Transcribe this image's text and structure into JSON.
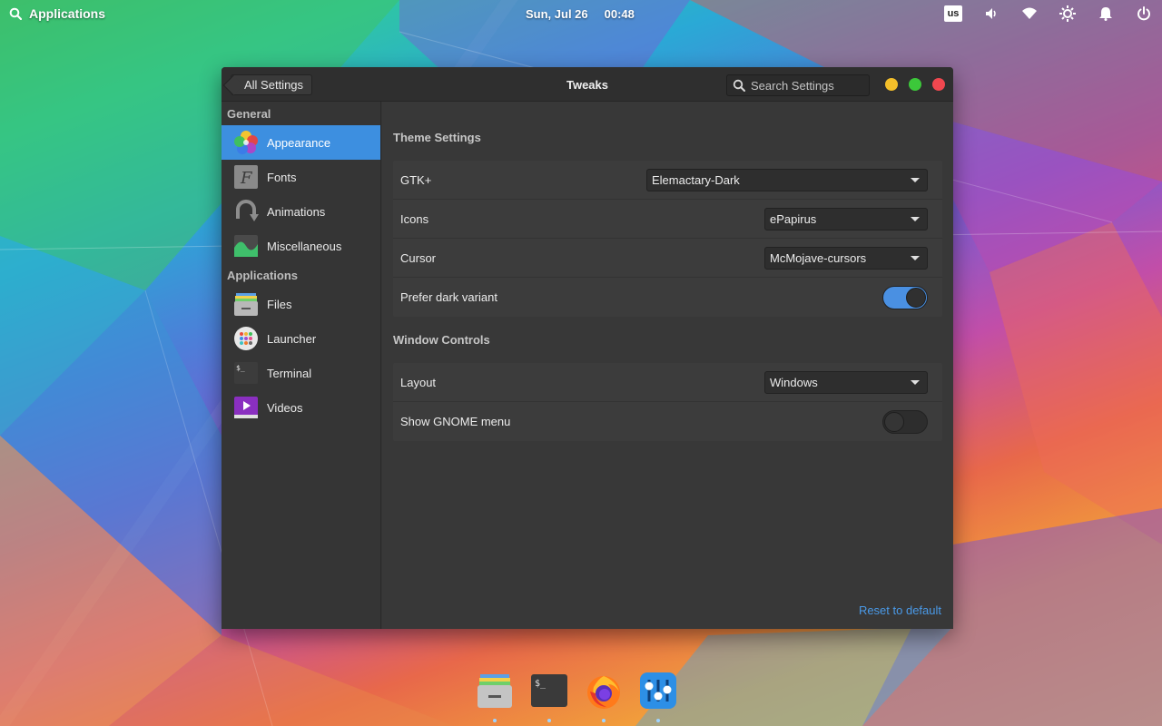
{
  "topbar": {
    "applications_label": "Applications",
    "date": "Sun, Jul 26",
    "time": "00:48",
    "keyboard_layout": "us"
  },
  "window": {
    "back_label": "All Settings",
    "title": "Tweaks",
    "search_placeholder": "Search Settings"
  },
  "sidebar": {
    "general_header": "General",
    "applications_header": "Applications",
    "general_items": [
      {
        "label": "Appearance",
        "icon": "appearance-icon",
        "active": true
      },
      {
        "label": "Fonts",
        "icon": "fonts-icon"
      },
      {
        "label": "Animations",
        "icon": "animations-icon"
      },
      {
        "label": "Miscellaneous",
        "icon": "miscellaneous-icon"
      }
    ],
    "app_items": [
      {
        "label": "Files",
        "icon": "files-icon"
      },
      {
        "label": "Launcher",
        "icon": "launcher-icon"
      },
      {
        "label": "Terminal",
        "icon": "terminal-icon"
      },
      {
        "label": "Videos",
        "icon": "videos-icon"
      }
    ]
  },
  "theme_settings": {
    "title": "Theme Settings",
    "gtk_label": "GTK+",
    "gtk_value": "Elemactary-Dark",
    "icons_label": "Icons",
    "icons_value": "ePapirus",
    "cursor_label": "Cursor",
    "cursor_value": "McMojave-cursors",
    "dark_label": "Prefer dark variant",
    "dark_enabled": true
  },
  "window_controls": {
    "title": "Window Controls",
    "layout_label": "Layout",
    "layout_value": "Windows",
    "gnome_menu_label": "Show GNOME menu",
    "gnome_menu_enabled": false
  },
  "reset_label": "Reset to default",
  "dock": [
    "files-icon",
    "terminal-icon",
    "firefox-icon",
    "tweaks-icon"
  ],
  "colors": {
    "accent": "#3d8fe0",
    "link": "#4a9ae8",
    "minimize": "#f4bf2a",
    "maximize": "#3cc83a",
    "close": "#f0474f"
  }
}
